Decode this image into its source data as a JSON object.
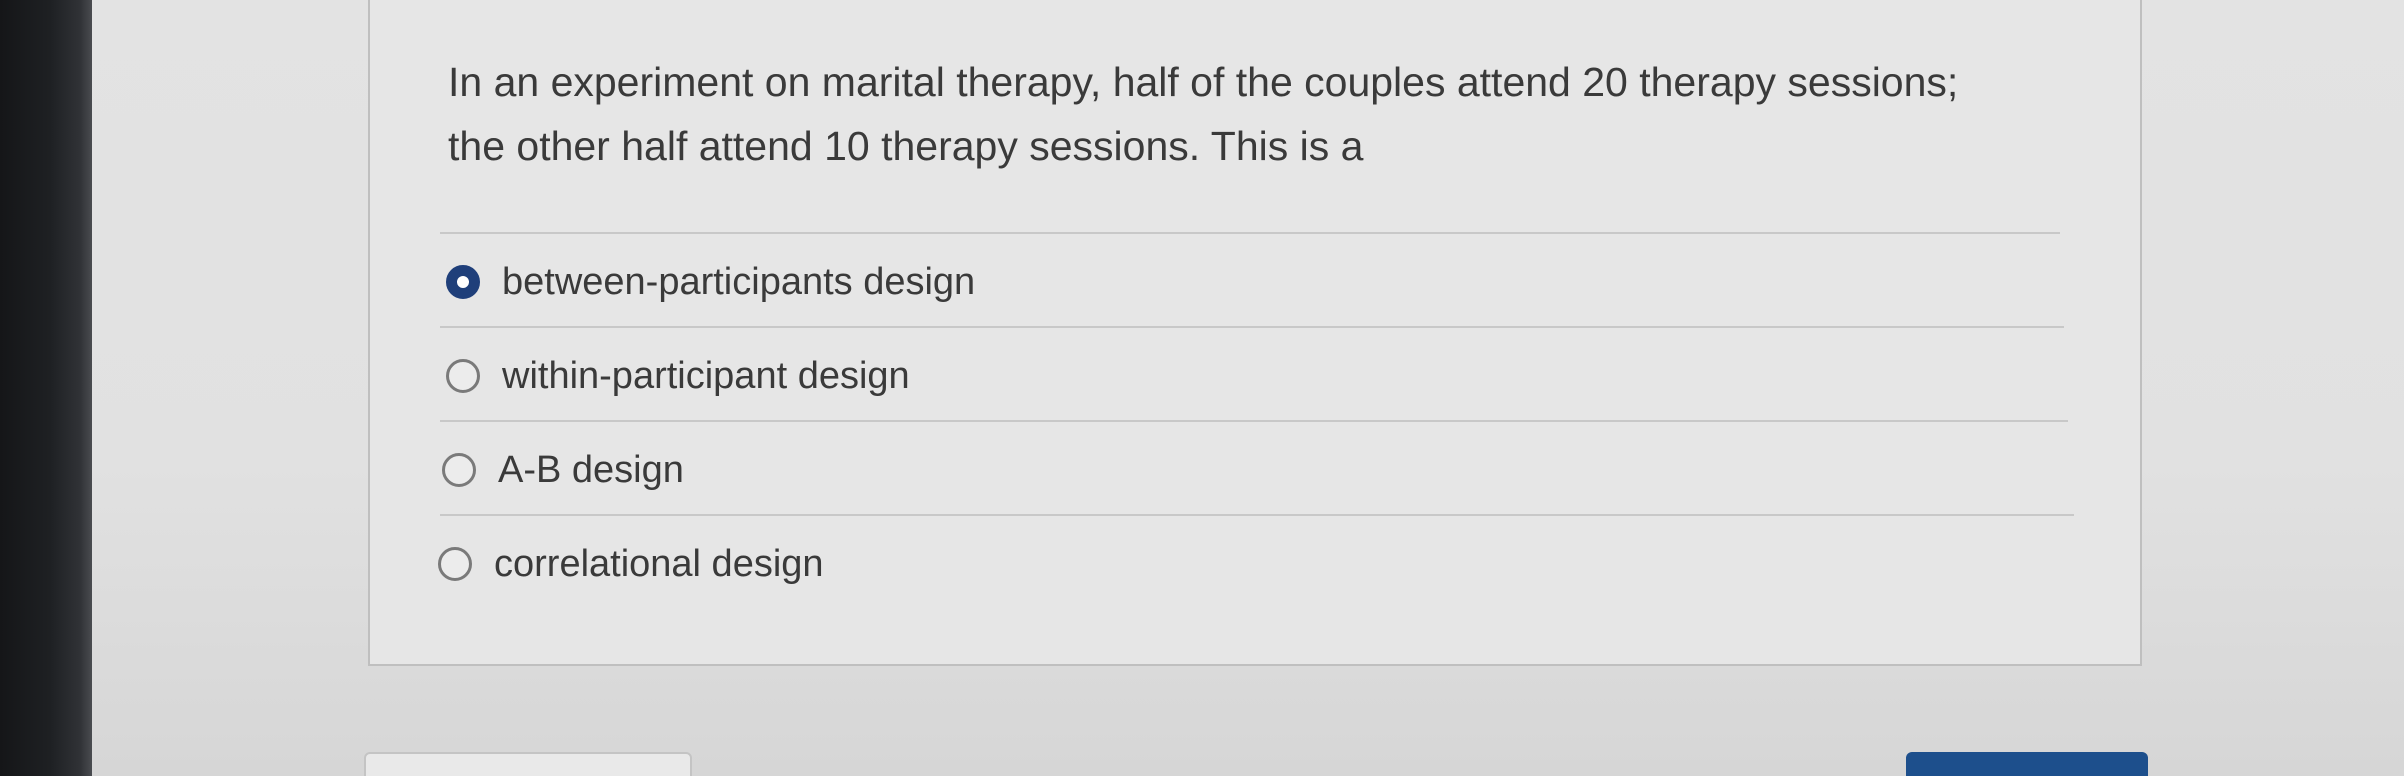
{
  "question": {
    "text": "In an experiment on marital therapy, half of the couples attend 20 therapy sessions; the other half attend 10 therapy sessions. This is a",
    "selected_index": 0,
    "options": [
      {
        "label": "between-participants design",
        "selected": true
      },
      {
        "label": "within-participant design",
        "selected": false
      },
      {
        "label": "A-B design",
        "selected": false
      },
      {
        "label": "correlational design",
        "selected": false
      }
    ]
  },
  "colors": {
    "selected_radio": "#1f3f7a",
    "primary_button": "#1d4f8c"
  }
}
